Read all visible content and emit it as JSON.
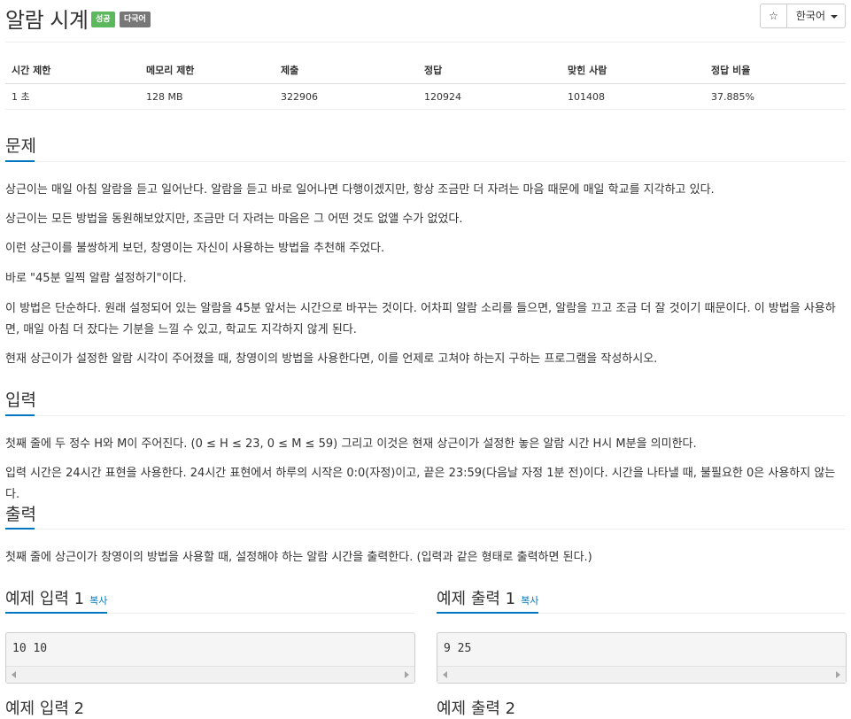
{
  "problem": {
    "title": "알람 시계",
    "badges": {
      "success": "성공",
      "multilang": "다국어"
    }
  },
  "toolbar": {
    "star_icon": "☆",
    "language": "한국어"
  },
  "info_table": {
    "headers": [
      "시간 제한",
      "메모리 제한",
      "제출",
      "정답",
      "맞힌 사람",
      "정답 비율"
    ],
    "values": [
      "1 초",
      "128 MB",
      "322906",
      "120924",
      "101408",
      "37.885%"
    ]
  },
  "sections": {
    "description": {
      "heading": "문제",
      "paragraphs": [
        "상근이는 매일 아침 알람을 듣고 일어난다. 알람을 듣고 바로 일어나면 다행이겠지만, 항상 조금만 더 자려는 마음 때문에 매일 학교를 지각하고 있다.",
        "상근이는 모든 방법을 동원해보았지만, 조금만 더 자려는 마음은 그 어떤 것도 없앨 수가 없었다.",
        "이런 상근이를 불쌍하게 보던, 창영이는 자신이 사용하는 방법을 추천해 주었다.",
        "바로 \"45분 일찍 알람 설정하기\"이다.",
        "이 방법은 단순하다. 원래 설정되어 있는 알람을 45분 앞서는 시간으로 바꾸는 것이다. 어차피 알람 소리를 들으면, 알람을 끄고 조금 더 잘 것이기 때문이다. 이 방법을 사용하면, 매일 아침 더 잤다는 기분을 느낄 수 있고, 학교도 지각하지 않게 된다.",
        "현재 상근이가 설정한 알람 시각이 주어졌을 때, 창영이의 방법을 사용한다면, 이를 언제로 고쳐야 하는지 구하는 프로그램을 작성하시오."
      ]
    },
    "input": {
      "heading": "입력",
      "paragraphs": [
        "첫째 줄에 두 정수 H와 M이 주어진다. (0 ≤ H ≤ 23, 0 ≤ M ≤ 59) 그리고 이것은 현재 상근이가 설정한 놓은 알람 시간 H시 M분을 의미한다.",
        "입력 시간은 24시간 표현을 사용한다. 24시간 표현에서 하루의 시작은 0:0(자정)이고, 끝은 23:59(다음날 자정 1분 전)이다. 시간을 나타낼 때, 불필요한 0은 사용하지 않는다."
      ]
    },
    "output": {
      "heading": "출력",
      "paragraphs": [
        "첫째 줄에 상근이가 창영이의 방법을 사용할 때, 설정해야 하는 알람 시간을 출력한다. (입력과 같은 형태로 출력하면 된다.)"
      ]
    }
  },
  "samples": {
    "input1": {
      "heading": "예제 입력 1",
      "copy": "복사",
      "content": "10 10"
    },
    "output1": {
      "heading": "예제 출력 1",
      "copy": "복사",
      "content": "9 25"
    },
    "input2": {
      "heading": "예제 입력 2"
    },
    "output2": {
      "heading": "예제 출력 2"
    }
  }
}
